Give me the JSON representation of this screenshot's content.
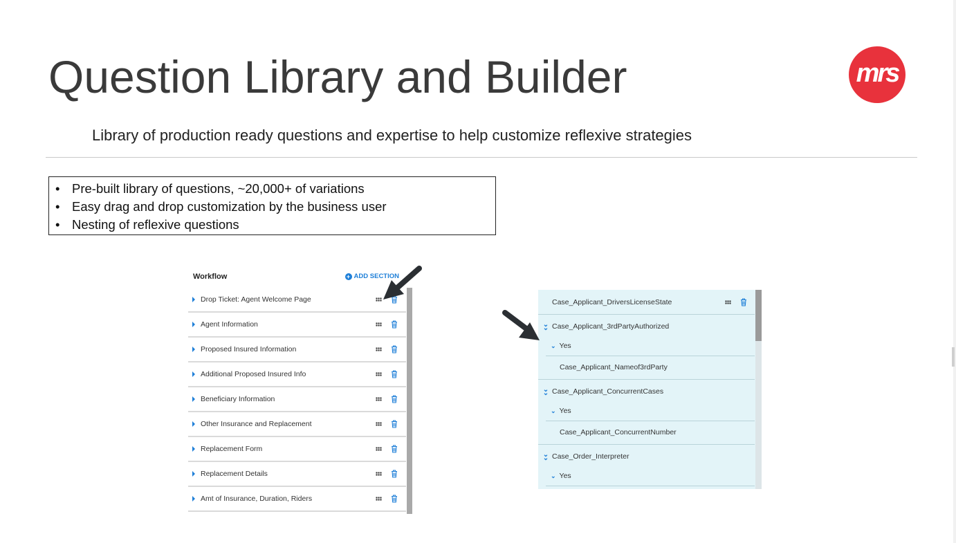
{
  "slide": {
    "title": "Question Library and Builder",
    "subtitle": "Library of production ready questions and expertise to help customize reflexive strategies",
    "logo_text": "mrs",
    "brand_color": "#e8323c",
    "bullets": [
      "Pre-built library of questions, ~20,000+ of variations",
      "Easy drag and drop customization by the business user",
      "Nesting of reflexive questions"
    ]
  },
  "workflow": {
    "title": "Workflow",
    "add_section_label": "ADD SECTION",
    "accent_color": "#1e7fd8",
    "items": [
      {
        "label": "Drop Ticket: Agent Welcome Page"
      },
      {
        "label": "Agent Information"
      },
      {
        "label": "Proposed Insured Information"
      },
      {
        "label": "Additional Proposed Insured Info"
      },
      {
        "label": "Beneficiary Information"
      },
      {
        "label": "Other Insurance and Replacement"
      },
      {
        "label": "Replacement Form"
      },
      {
        "label": "Replacement Details"
      },
      {
        "label": "Amt of Insurance, Duration, Riders"
      }
    ]
  },
  "builder": {
    "background": "#e3f4f8",
    "top_question": "Case_Applicant_DriversLicenseState",
    "groups": [
      {
        "question": "Case_Applicant_3rdPartyAuthorized",
        "answer": "Yes",
        "child": "Case_Applicant_Nameof3rdParty"
      },
      {
        "question": "Case_Applicant_ConcurrentCases",
        "answer": "Yes",
        "child": "Case_Applicant_ConcurrentNumber"
      },
      {
        "question": "Case_Order_Interpreter",
        "answer": "Yes"
      }
    ]
  }
}
